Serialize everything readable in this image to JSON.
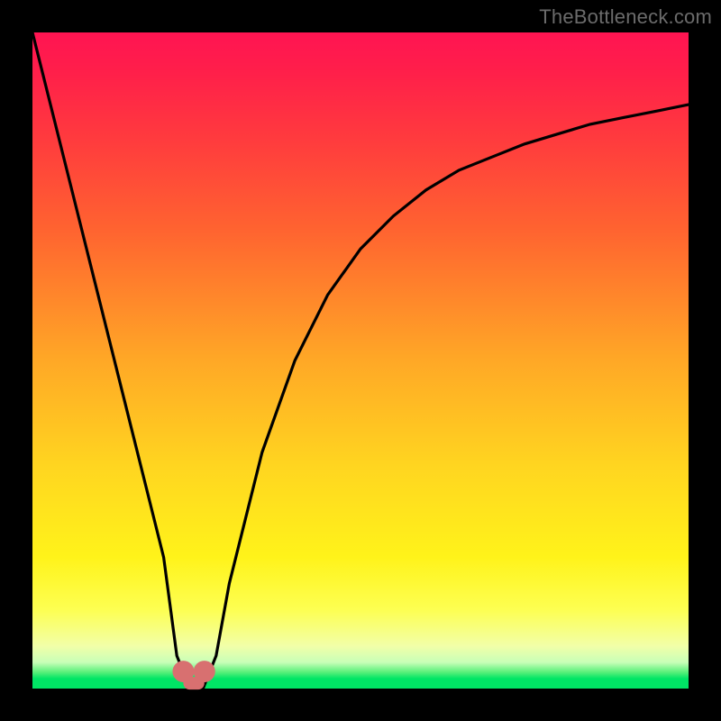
{
  "watermark": "TheBottleneck.com",
  "chart_data": {
    "type": "line",
    "title": "",
    "xlabel": "",
    "ylabel": "",
    "xlim": [
      0,
      100
    ],
    "ylim": [
      0,
      100
    ],
    "series": [
      {
        "name": "bottleneck-curve",
        "x": [
          0,
          5,
          10,
          15,
          20,
          22,
          24,
          26,
          28,
          30,
          35,
          40,
          45,
          50,
          55,
          60,
          65,
          70,
          75,
          80,
          85,
          90,
          95,
          100
        ],
        "y": [
          100,
          80,
          60,
          40,
          20,
          5,
          0,
          0,
          5,
          16,
          36,
          50,
          60,
          67,
          72,
          76,
          79,
          81,
          83,
          84.5,
          86,
          87,
          88,
          89
        ]
      }
    ],
    "markers": [
      {
        "name": "dip-left",
        "x": 23.0,
        "y": 2.6
      },
      {
        "name": "dip-right",
        "x": 26.2,
        "y": 2.6
      }
    ],
    "marker_color": "#d87070",
    "marker_radius_px": 12,
    "dip_bar": {
      "x0": 23.0,
      "x1": 26.2,
      "y": 0.8,
      "color": "#d87070",
      "thickness_px": 14
    }
  },
  "colors": {
    "background": "#000000",
    "curve": "#000000",
    "gradient_top": "#ff1452",
    "gradient_bottom": "#00e565"
  }
}
